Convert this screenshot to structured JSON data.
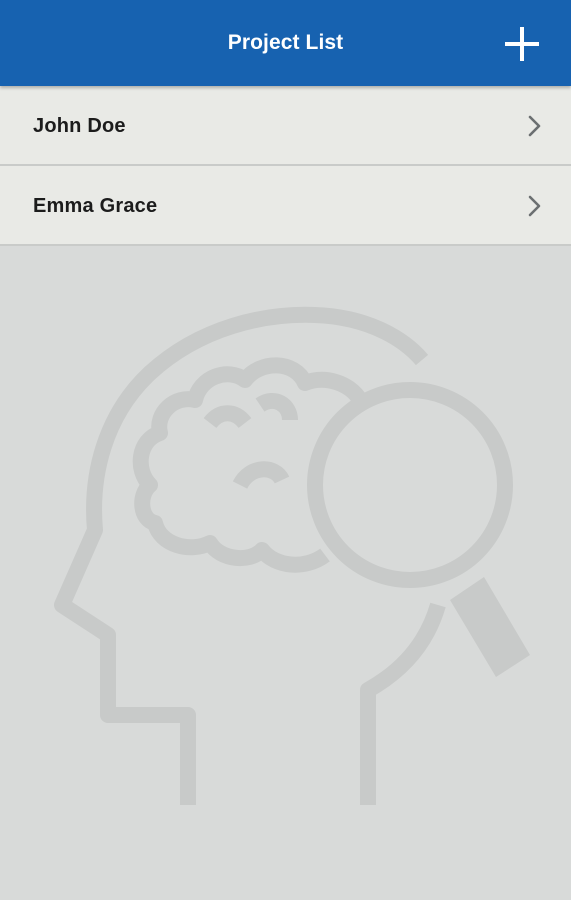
{
  "header": {
    "title": "Project List",
    "add_icon": "plus-icon",
    "background_color": "#1762b0"
  },
  "projects": [
    {
      "name": "John Doe",
      "icon": "chevron-right-icon"
    },
    {
      "name": "Emma Grace",
      "icon": "chevron-right-icon"
    }
  ],
  "empty_state": {
    "illustration": "head-brain-magnifier-icon"
  }
}
